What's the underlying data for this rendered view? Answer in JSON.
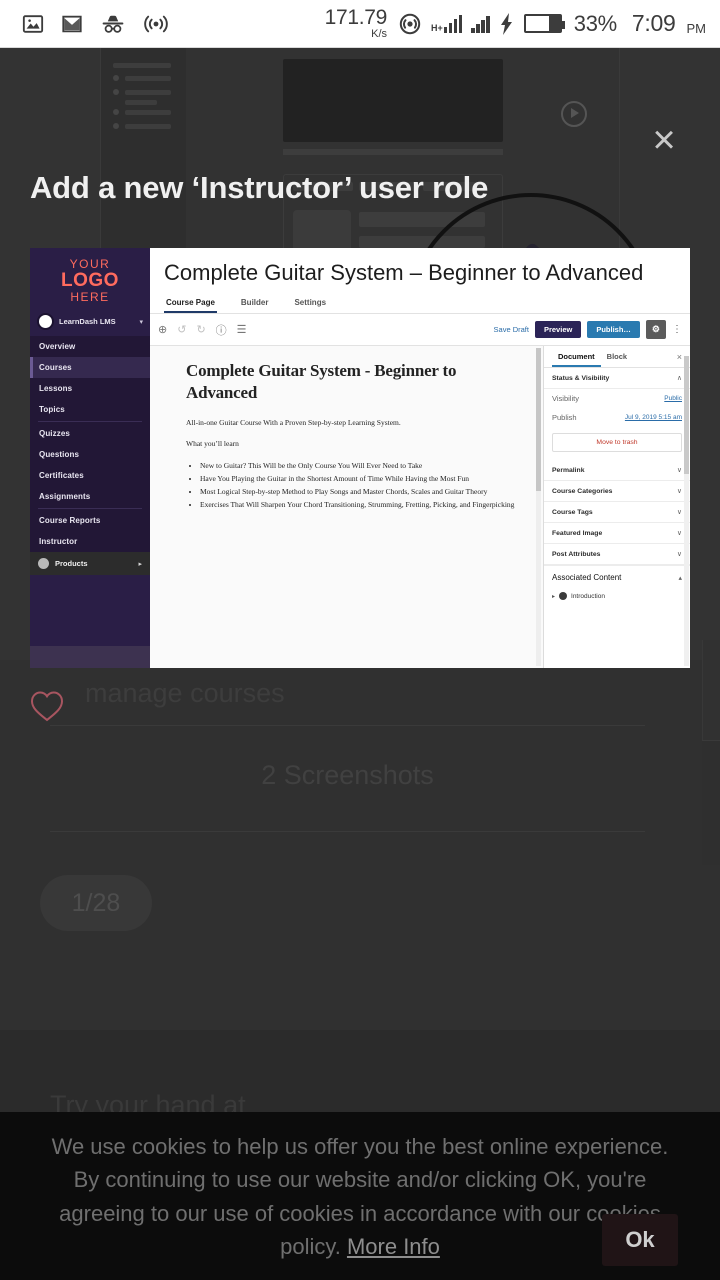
{
  "statusbar": {
    "icons": [
      "image-icon",
      "gmail-icon",
      "incognito-icon",
      "hotspot-icon"
    ],
    "net_speed_value": "171.79",
    "net_speed_unit": "K/s",
    "network_type": "H+",
    "battery_percent": "33%",
    "time": "7:09",
    "ampm": "PM"
  },
  "overlay": {
    "title": "Add a new ‘Instructor’ user role",
    "close_label": "×"
  },
  "screenshot": {
    "sidebar": {
      "logo_line1": "YOUR",
      "logo_line2": "LOGO",
      "logo_line3": "HERE",
      "account_name": "LearnDash LMS",
      "caret": "▾",
      "items": [
        {
          "label": "Overview",
          "active": false
        },
        {
          "label": "Courses",
          "active": true
        },
        {
          "label": "Lessons",
          "active": false
        },
        {
          "label": "Topics",
          "active": false
        },
        {
          "label": "Quizzes",
          "active": false
        },
        {
          "label": "Questions",
          "active": false
        },
        {
          "label": "Certificates",
          "active": false
        },
        {
          "label": "Assignments",
          "active": false
        },
        {
          "label": "Course Reports",
          "active": false
        },
        {
          "label": "Instructor",
          "active": false
        }
      ],
      "products_label": "Products",
      "products_arrow": "▸"
    },
    "editor": {
      "post_title": "Complete Guitar System – Beginner to Advanced",
      "tabs": [
        {
          "label": "Course Page",
          "selected": true
        },
        {
          "label": "Builder",
          "selected": false
        },
        {
          "label": "Settings",
          "selected": false
        }
      ],
      "toolbar": {
        "add_icon": "⊕",
        "undo_icon": "↺",
        "redo_icon": "↻",
        "info_icon": "ⓘ",
        "listview_icon": "☰",
        "save_draft": "Save Draft",
        "preview": "Preview",
        "publish": "Publish…",
        "gear_icon": "⚙",
        "more_icon": "⋮"
      },
      "document": {
        "heading": "Complete Guitar System - Beginner to Advanced",
        "intro": "All-in-one Guitar Course With a Proven Step-by-step Learning System.",
        "subheading": "What you’ll learn",
        "bullets": [
          "New to Guitar? This Will be the Only Course You Will Ever Need to Take",
          "Have You Playing the Guitar in the Shortest Amount of Time While Having the Most Fun",
          "Most Logical Step-by-step Method to Play Songs and Master Chords, Scales and Guitar Theory",
          "Exercises That Will Sharpen Your Chord Transitioning, Strumming, Fretting, Picking, and Fingerpicking"
        ]
      },
      "panel": {
        "tab_document": "Document",
        "tab_block": "Block",
        "close_icon": "×",
        "status_visibility": "Status & Visibility",
        "collapse_icon": "∧",
        "visibility_label": "Visibility",
        "visibility_value": "Public",
        "publish_label": "Publish",
        "publish_value": "Jul 9, 2019 5:15 am",
        "move_to_trash": "Move to trash",
        "sections": [
          {
            "label": "Permalink",
            "icon": "∨"
          },
          {
            "label": "Course Categories",
            "icon": "∨"
          },
          {
            "label": "Course Tags",
            "icon": "∨"
          },
          {
            "label": "Featured Image",
            "icon": "∨"
          },
          {
            "label": "Post Attributes",
            "icon": "∨"
          }
        ],
        "associated_content": "Associated Content",
        "associated_icon": "▴",
        "first_child": "Introduction"
      }
    }
  },
  "listing": {
    "caption": "manage courses",
    "screenshot_count": "2 Screenshots",
    "pager": "1/28",
    "next_section_title": "Try your hand at",
    "favorite_icon": "heart-icon",
    "accent_heart": "#a85560"
  },
  "cookie_banner": {
    "text_part1": "We use cookies to help us offer you the best online experience. By continuing to use our website and/or clicking OK, you're agreeing to our use of cookies in accordance with our cookies policy. ",
    "more_info": "More Info",
    "ok_label": "Ok"
  },
  "colors": {
    "brand_purple": "#2a1e46",
    "brand_coral": "#ff6b5e",
    "publish_blue": "#2a7ab0",
    "preview_navy": "#2b2457",
    "trash_red": "#c0392b",
    "page_bg": "#303030"
  }
}
